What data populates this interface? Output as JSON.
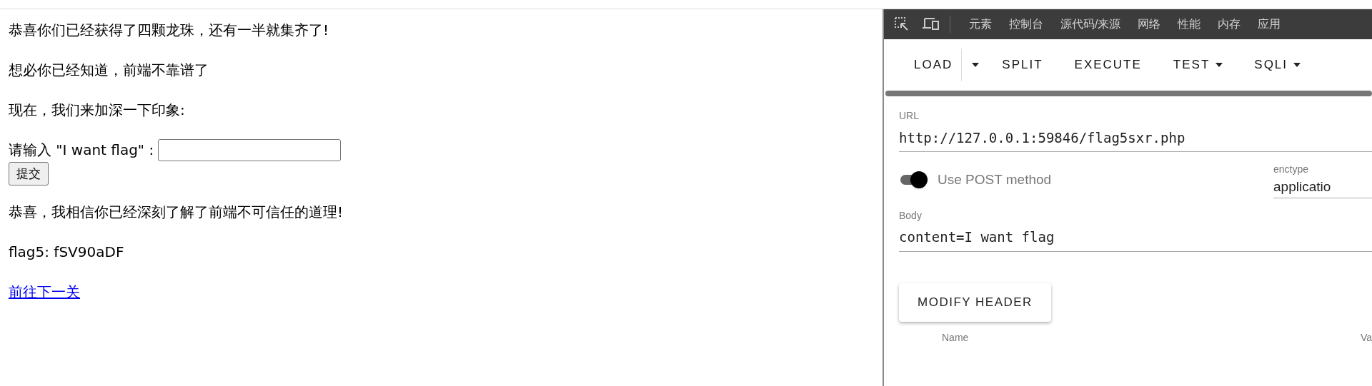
{
  "page": {
    "paragraphs": [
      "恭喜你们已经获得了四颗龙珠，还有一半就集齐了!",
      "想必你已经知道，前端不靠谱了",
      "现在，我们来加深一下印象:"
    ],
    "form": {
      "label": "请输入 \"I want flag\" :",
      "submit": "提交"
    },
    "results": [
      "恭喜，我相信你已经深刻了解了前端不可信任的道理!",
      "flag5: fSV90aDF"
    ],
    "link": "前往下一关"
  },
  "devtools": {
    "tabs": [
      {
        "label": "元素",
        "selected": false
      },
      {
        "label": "控制台",
        "selected": false
      },
      {
        "label": "源代码/来源",
        "selected": false
      },
      {
        "label": "网络",
        "selected": false
      },
      {
        "label": "性能",
        "selected": false
      },
      {
        "label": "内存",
        "selected": false
      },
      {
        "label": "应用",
        "selected": false
      }
    ],
    "toolbar": [
      {
        "label": "LOAD",
        "kind": "split"
      },
      {
        "label": "SPLIT",
        "kind": "plain"
      },
      {
        "label": "EXECUTE",
        "kind": "plain"
      },
      {
        "label": "TEST",
        "kind": "menu"
      },
      {
        "label": "SQLI",
        "kind": "menu"
      }
    ],
    "url": {
      "label": "URL",
      "value": "http://127.0.0.1:59846/flag5sxr.php"
    },
    "post_method": {
      "label": "Use POST method",
      "on": true
    },
    "enctype": {
      "label": "enctype",
      "value": "applicatio"
    },
    "body": {
      "label": "Body",
      "value": "content=I want flag"
    },
    "modify_header": "MODIFY HEADER",
    "header_columns": [
      "Name",
      "Va"
    ]
  }
}
